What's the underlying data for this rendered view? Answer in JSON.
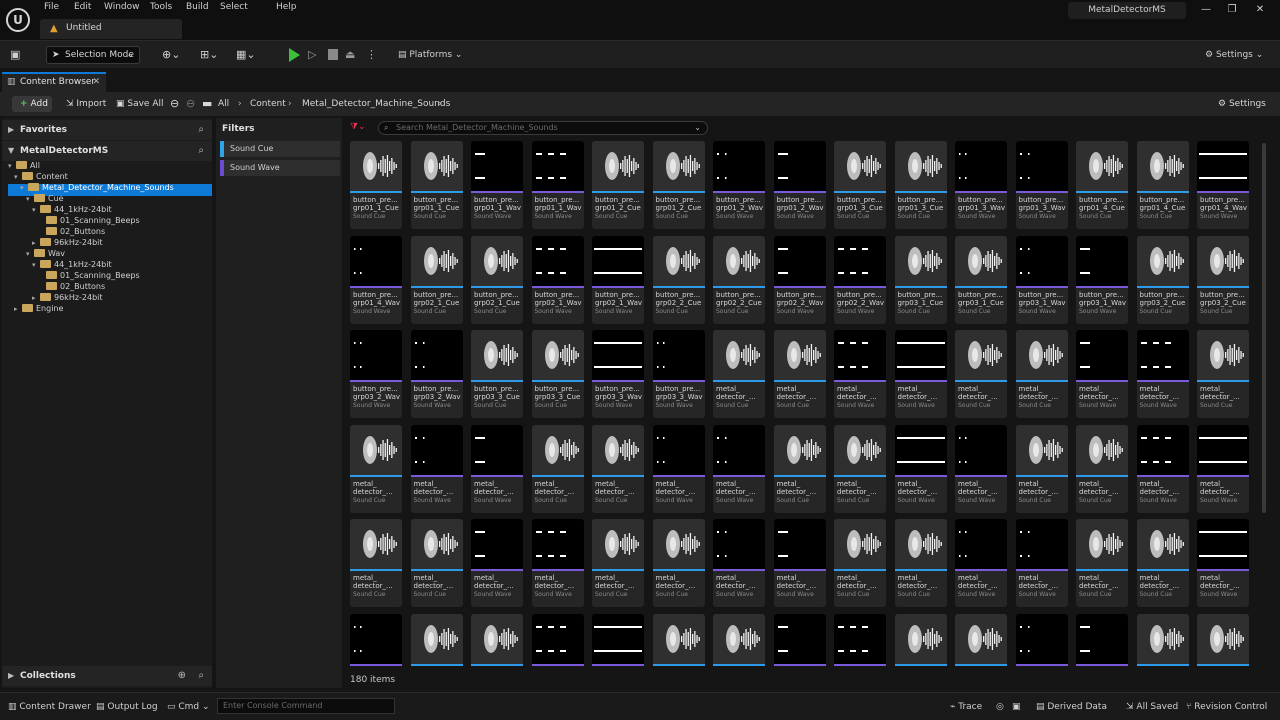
{
  "menu": [
    "File",
    "Edit",
    "Window",
    "Tools",
    "Build",
    "Select",
    "Help"
  ],
  "document_tab": "Untitled",
  "project_name": "MetalDetectorMS",
  "window_buttons": [
    "—",
    "❐",
    "✕"
  ],
  "toolbar": {
    "selection_mode": "Selection Mode",
    "platforms": "Platforms",
    "settings": "Settings"
  },
  "content_browser": {
    "tab_label": "Content Browser",
    "add": "Add",
    "import": "Import",
    "save_all": "Save All",
    "breadcrumb": [
      "All",
      "Content",
      "Metal_Detector_Machine_Sounds"
    ],
    "settings": "Settings",
    "search_placeholder": "Search Metal_Detector_Machine_Sounds",
    "item_count": "180 items"
  },
  "left_panel": {
    "favorites": "Favorites",
    "project": "MetalDetectorMS",
    "tree": [
      {
        "label": "All",
        "depth": 0
      },
      {
        "label": "Content",
        "depth": 1
      },
      {
        "label": "Metal_Detector_Machine_Sounds",
        "depth": 2,
        "selected": true
      },
      {
        "label": "Cue",
        "depth": 3
      },
      {
        "label": "44_1kHz-24bit",
        "depth": 4
      },
      {
        "label": "01_Scanning_Beeps",
        "depth": 5
      },
      {
        "label": "02_Buttons",
        "depth": 5
      },
      {
        "label": "96kHz-24bit",
        "depth": 4
      },
      {
        "label": "Wav",
        "depth": 3
      },
      {
        "label": "44_1kHz-24bit",
        "depth": 4
      },
      {
        "label": "01_Scanning_Beeps",
        "depth": 5
      },
      {
        "label": "02_Buttons",
        "depth": 5
      },
      {
        "label": "96kHz-24bit",
        "depth": 4
      },
      {
        "label": "Engine",
        "depth": 1
      }
    ],
    "collections": "Collections"
  },
  "filters": {
    "title": "Filters",
    "items": [
      {
        "label": "Sound Cue",
        "color": "#2fa4e7"
      },
      {
        "label": "Sound Wave",
        "color": "#6a4ecf"
      }
    ]
  },
  "asset_types": {
    "cue": {
      "label": "Sound Cue",
      "color": "#2f9be8"
    },
    "wave": {
      "label": "Sound Wave",
      "color": "#7a5ad8"
    }
  },
  "assets": [
    {
      "name": "button_pre...\ngrp01_1_Cue",
      "type": "cue"
    },
    {
      "name": "button_pre...\ngrp01_1_Cue",
      "type": "cue"
    },
    {
      "name": "button_pre...\ngrp01_1_Wav",
      "type": "wave"
    },
    {
      "name": "button_pre...\ngrp01_1_Wav",
      "type": "wave"
    },
    {
      "name": "button_pre...\ngrp01_2_Cue",
      "type": "cue"
    },
    {
      "name": "button_pre...\ngrp01_2_Cue",
      "type": "cue"
    },
    {
      "name": "button_pre...\ngrp01_2_Wav",
      "type": "wave"
    },
    {
      "name": "button_pre...\ngrp01_2_Wav",
      "type": "wave"
    },
    {
      "name": "button_pre...\ngrp01_3_Cue",
      "type": "cue"
    },
    {
      "name": "button_pre...\ngrp01_3_Cue",
      "type": "cue"
    },
    {
      "name": "button_pre...\ngrp01_3_Wav",
      "type": "wave"
    },
    {
      "name": "button_pre...\ngrp01_3_Wav",
      "type": "wave"
    },
    {
      "name": "button_pre...\ngrp01_4_Cue",
      "type": "cue"
    },
    {
      "name": "button_pre...\ngrp01_4_Cue",
      "type": "cue"
    },
    {
      "name": "button_pre...\ngrp01_4_Wav",
      "type": "wave"
    },
    {
      "name": "button_pre...\ngrp01_4_Wav",
      "type": "wave"
    },
    {
      "name": "button_pre...\ngrp02_1_Cue",
      "type": "cue"
    },
    {
      "name": "button_pre...\ngrp02_1_Cue",
      "type": "cue"
    },
    {
      "name": "button_pre...\ngrp02_1_Wav",
      "type": "wave"
    },
    {
      "name": "button_pre...\ngrp02_1_Wav",
      "type": "wave"
    },
    {
      "name": "button_pre...\ngrp02_2_Cue",
      "type": "cue"
    },
    {
      "name": "button_pre...\ngrp02_2_Cue",
      "type": "cue"
    },
    {
      "name": "button_pre...\ngrp02_2_Wav",
      "type": "wave"
    },
    {
      "name": "button_pre...\ngrp02_2_Wav",
      "type": "wave"
    },
    {
      "name": "button_pre...\ngrp03_1_Cue",
      "type": "cue"
    },
    {
      "name": "button_pre...\ngrp03_1_Cue",
      "type": "cue"
    },
    {
      "name": "button_pre...\ngrp03_1_Wav",
      "type": "wave"
    },
    {
      "name": "button_pre...\ngrp03_1_Wav",
      "type": "wave"
    },
    {
      "name": "button_pre...\ngrp03_2_Cue",
      "type": "cue"
    },
    {
      "name": "button_pre...\ngrp03_2_Cue",
      "type": "cue"
    },
    {
      "name": "button_pre...\ngrp03_2_Wav",
      "type": "wave"
    },
    {
      "name": "button_pre...\ngrp03_2_Wav",
      "type": "wave"
    },
    {
      "name": "button_pre...\ngrp03_3_Cue",
      "type": "cue"
    },
    {
      "name": "button_pre...\ngrp03_3_Cue",
      "type": "cue"
    },
    {
      "name": "button_pre...\ngrp03_3_Wav",
      "type": "wave"
    },
    {
      "name": "button_pre...\ngrp03_3_Wav",
      "type": "wave"
    },
    {
      "name": "metal_\ndetector_...",
      "type": "cue"
    },
    {
      "name": "metal_\ndetector_...",
      "type": "cue"
    },
    {
      "name": "metal_\ndetector_...",
      "type": "wave"
    },
    {
      "name": "metal_\ndetector_...",
      "type": "wave"
    },
    {
      "name": "metal_\ndetector_...",
      "type": "cue"
    },
    {
      "name": "metal_\ndetector_...",
      "type": "cue"
    },
    {
      "name": "metal_\ndetector_...",
      "type": "wave"
    },
    {
      "name": "metal_\ndetector_...",
      "type": "wave"
    },
    {
      "name": "metal_\ndetector_...",
      "type": "cue"
    },
    {
      "name": "metal_\ndetector_...",
      "type": "cue"
    },
    {
      "name": "metal_\ndetector_...",
      "type": "wave"
    },
    {
      "name": "metal_\ndetector_...",
      "type": "wave"
    },
    {
      "name": "metal_\ndetector_...",
      "type": "cue"
    },
    {
      "name": "metal_\ndetector_...",
      "type": "cue"
    },
    {
      "name": "metal_\ndetector_...",
      "type": "wave"
    },
    {
      "name": "metal_\ndetector_...",
      "type": "wave"
    },
    {
      "name": "metal_\ndetector_...",
      "type": "cue"
    },
    {
      "name": "metal_\ndetector_...",
      "type": "cue"
    },
    {
      "name": "metal_\ndetector_...",
      "type": "wave"
    },
    {
      "name": "metal_\ndetector_...",
      "type": "wave"
    },
    {
      "name": "metal_\ndetector_...",
      "type": "cue"
    },
    {
      "name": "metal_\ndetector_...",
      "type": "cue"
    },
    {
      "name": "metal_\ndetector_...",
      "type": "wave"
    },
    {
      "name": "metal_\ndetector_...",
      "type": "wave"
    },
    {
      "name": "metal_\ndetector_...",
      "type": "cue"
    },
    {
      "name": "metal_\ndetector_...",
      "type": "cue"
    },
    {
      "name": "metal_\ndetector_...",
      "type": "wave"
    },
    {
      "name": "metal_\ndetector_...",
      "type": "wave"
    },
    {
      "name": "metal_\ndetector_...",
      "type": "cue"
    },
    {
      "name": "metal_\ndetector_...",
      "type": "cue"
    },
    {
      "name": "metal_\ndetector_...",
      "type": "wave"
    },
    {
      "name": "metal_\ndetector_...",
      "type": "wave"
    },
    {
      "name": "metal_\ndetector_...",
      "type": "cue"
    },
    {
      "name": "metal_\ndetector_...",
      "type": "cue"
    },
    {
      "name": "metal_\ndetector_...",
      "type": "wave"
    },
    {
      "name": "metal_\ndetector_...",
      "type": "wave"
    },
    {
      "name": "metal_\ndetector_...",
      "type": "cue"
    },
    {
      "name": "metal_\ndetector_...",
      "type": "cue"
    },
    {
      "name": "metal_\ndetector_...",
      "type": "wave"
    },
    {
      "name": "",
      "type": "wave"
    },
    {
      "name": "",
      "type": "cue"
    },
    {
      "name": "",
      "type": "cue"
    },
    {
      "name": "",
      "type": "wave"
    },
    {
      "name": "",
      "type": "wave"
    },
    {
      "name": "",
      "type": "cue"
    },
    {
      "name": "",
      "type": "cue"
    },
    {
      "name": "",
      "type": "wave"
    },
    {
      "name": "",
      "type": "wave"
    },
    {
      "name": "",
      "type": "cue"
    },
    {
      "name": "",
      "type": "cue"
    },
    {
      "name": "",
      "type": "wave"
    },
    {
      "name": "",
      "type": "wave"
    },
    {
      "name": "",
      "type": "cue"
    },
    {
      "name": "",
      "type": "cue"
    }
  ],
  "statusbar": {
    "content_drawer": "Content Drawer",
    "output_log": "Output Log",
    "cmd": "Cmd",
    "console_placeholder": "Enter Console Command",
    "trace": "Trace",
    "derived_data": "Derived Data",
    "all_saved": "All Saved",
    "revision_control": "Revision Control"
  }
}
